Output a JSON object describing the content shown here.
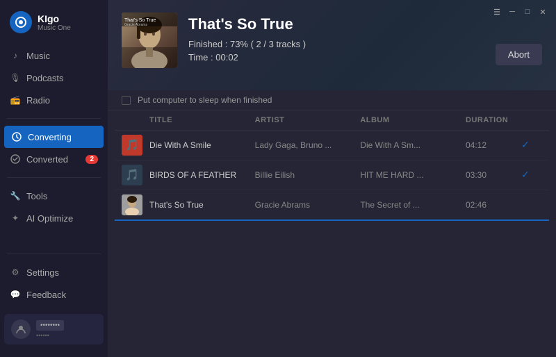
{
  "app": {
    "name": "KIgo",
    "subtitle": "Music One"
  },
  "sidebar": {
    "nav": [
      {
        "id": "music",
        "label": "Music",
        "icon": "♪",
        "active": false
      },
      {
        "id": "podcasts",
        "label": "Podcasts",
        "icon": "🎙",
        "active": false
      },
      {
        "id": "radio",
        "label": "Radio",
        "icon": "📻",
        "active": false
      }
    ],
    "status": [
      {
        "id": "converting",
        "label": "Converting",
        "icon": "⟳",
        "active": true,
        "badge": null
      },
      {
        "id": "converted",
        "label": "Converted",
        "icon": "✓",
        "active": false,
        "badge": "2"
      }
    ],
    "tools": [
      {
        "id": "tools",
        "label": "Tools",
        "icon": "🔧",
        "active": false
      },
      {
        "id": "ai-optimize",
        "label": "AI Optimize",
        "icon": "✦",
        "active": false
      }
    ],
    "bottom": [
      {
        "id": "settings",
        "label": "Settings",
        "icon": "⚙",
        "active": false
      },
      {
        "id": "feedback",
        "label": "Feedback",
        "icon": "💬",
        "active": false
      }
    ],
    "user": {
      "name": "••••••••",
      "email": "••••••"
    }
  },
  "header": {
    "album_title": "That's So True",
    "progress_text": "Finished : 73% ( 2 / 3 tracks )",
    "time_text": "Time : 00:02",
    "abort_label": "Abort",
    "sleep_label": "Put computer to sleep when finished"
  },
  "titlebar": {
    "menu_icon": "☰",
    "minimize_icon": "─",
    "maximize_icon": "□",
    "close_icon": "✕"
  },
  "table": {
    "columns": [
      "",
      "TITLE",
      "ARTIST",
      "ALBUM",
      "DURATION",
      ""
    ],
    "rows": [
      {
        "title": "Die With A Smile",
        "artist": "Lady Gaga, Bruno ...",
        "album": "Die With A Sm...",
        "duration": "04:12",
        "done": true,
        "thumb": "1"
      },
      {
        "title": "BIRDS OF A FEATHER",
        "artist": "Billie Eilish",
        "album": "HIT ME HARD ...",
        "duration": "03:30",
        "done": true,
        "thumb": "2"
      },
      {
        "title": "That's So True",
        "artist": "Gracie Abrams",
        "album": "The Secret of ...",
        "duration": "02:46",
        "done": false,
        "thumb": "3"
      }
    ]
  }
}
